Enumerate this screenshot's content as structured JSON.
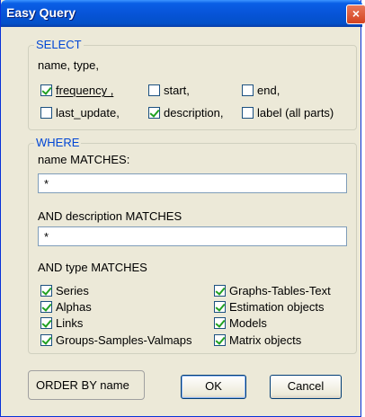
{
  "window": {
    "title": "Easy Query",
    "close_glyph": "×"
  },
  "select": {
    "legend": "SELECT",
    "fixed_fields": "name, type,",
    "options": [
      {
        "label": "frequency ,",
        "checked": true,
        "accel": "f"
      },
      {
        "label": "start,",
        "checked": false,
        "accel": "s"
      },
      {
        "label": "end,",
        "checked": false,
        "accel": "e"
      },
      {
        "label": "last_update,",
        "checked": false,
        "accel": ""
      },
      {
        "label": "description,",
        "checked": true,
        "accel": "d"
      },
      {
        "label": "label (all parts)",
        "checked": false,
        "accel": "l"
      }
    ]
  },
  "where": {
    "legend": "WHERE",
    "name_label": "name MATCHES:",
    "name_value": "*",
    "desc_label": "AND description MATCHES",
    "desc_value": "*",
    "type_label": "AND type MATCHES",
    "types": [
      {
        "label": "Series",
        "checked": true
      },
      {
        "label": "Alphas",
        "checked": true
      },
      {
        "label": "Links",
        "checked": true
      },
      {
        "label": "Groups-Samples-Valmaps",
        "checked": true
      },
      {
        "label": "Graphs-Tables-Text",
        "checked": true
      },
      {
        "label": "Estimation objects",
        "checked": true
      },
      {
        "label": "Models",
        "checked": true
      },
      {
        "label": "Matrix objects",
        "checked": true
      }
    ]
  },
  "order_by": "ORDER BY name",
  "buttons": {
    "ok": "OK",
    "cancel": "Cancel"
  },
  "colors": {
    "title_bar": "#0754d8",
    "legend": "#0046d5",
    "checkmark": "#21a121",
    "dialog_bg": "#ece9d8"
  }
}
